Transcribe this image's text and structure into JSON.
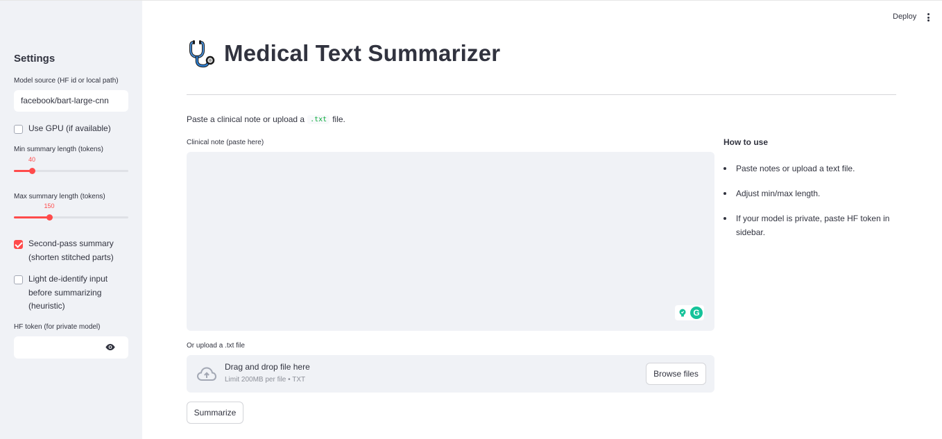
{
  "header": {
    "deploy_label": "Deploy",
    "menu_icon": "more-vert-icon"
  },
  "sidebar": {
    "title": "Settings",
    "model_source": {
      "label": "Model source (HF id or local path)",
      "value": "facebook/bart-large-cnn"
    },
    "use_gpu": {
      "label": "Use GPU (if available)",
      "checked": false
    },
    "min_length": {
      "label": "Min summary length (tokens)",
      "value": "40",
      "fraction": 0.16
    },
    "max_length": {
      "label": "Max summary length (tokens)",
      "value": "150",
      "fraction": 0.31
    },
    "second_pass": {
      "label": "Second-pass summary (shorten stitched parts)",
      "checked": true
    },
    "deidentify": {
      "label": "Light de-identify input before summarizing (heuristic)",
      "checked": false
    },
    "hf_token": {
      "label": "HF token (for private model)",
      "value": "",
      "icon": "eye-icon"
    }
  },
  "main": {
    "title": "Medical Text Summarizer",
    "title_icon": "stethoscope-icon",
    "intro_before": "Paste a clinical note or upload a",
    "intro_code": ".txt",
    "intro_after": "file.",
    "note_label": "Clinical note (paste here)",
    "note_value": "",
    "upload_label": "Or upload a .txt file",
    "uploader": {
      "main_text": "Drag and drop file here",
      "sub_text": "Limit 200MB per file • TXT",
      "browse_label": "Browse files"
    },
    "summarize_label": "Summarize"
  },
  "how_to_use": {
    "title": "How to use",
    "items": [
      "Paste notes or upload a text file.",
      "Adjust min/max length.",
      "If your model is private, paste HF token in sidebar."
    ]
  },
  "colors": {
    "accent": "#ff4b4b",
    "sidebar_bg": "#f0f2f6",
    "text": "#31333f"
  }
}
